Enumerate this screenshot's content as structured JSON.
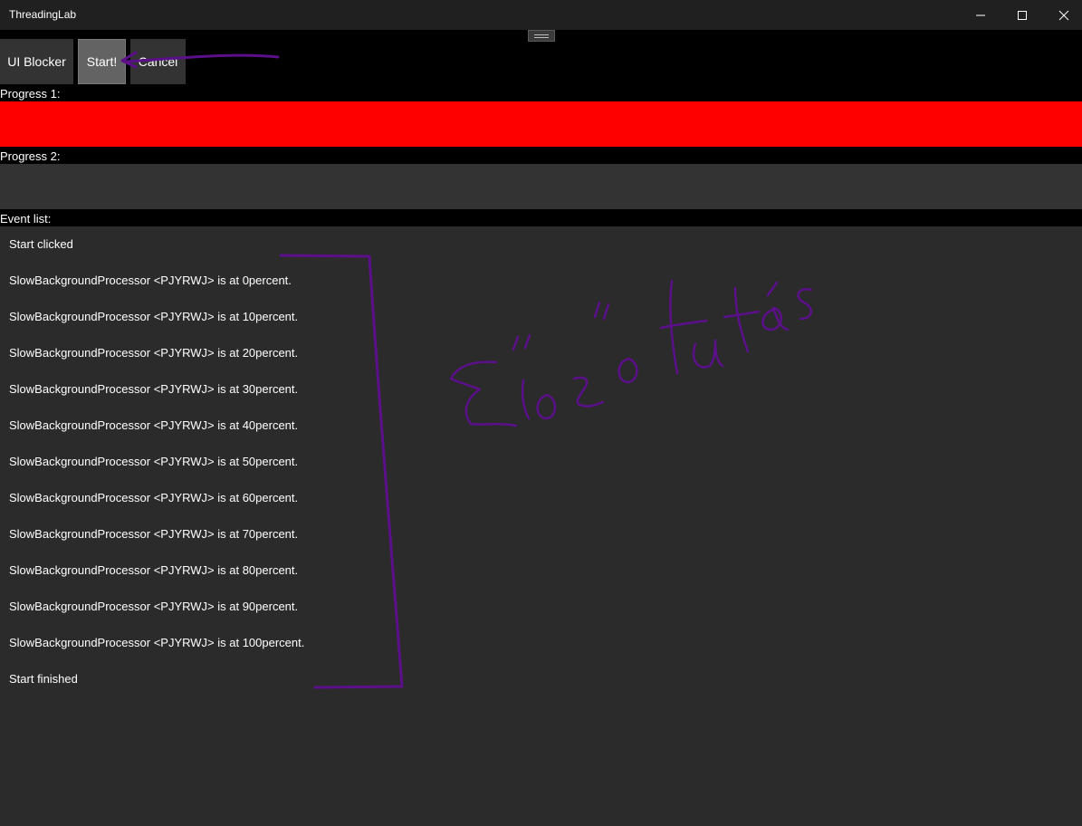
{
  "window": {
    "title": "ThreadingLab"
  },
  "toolbar": {
    "ui_blocker_label": "UI Blocker",
    "start_label": "Start!",
    "cancel_label": "Cancel"
  },
  "progress1": {
    "label": "Progress 1:",
    "value_percent": 100,
    "fill_color": "#ff0000"
  },
  "progress2": {
    "label": "Progress 2:",
    "value_percent": 0,
    "fill_color": "#ff0000"
  },
  "events": {
    "label": "Event list:",
    "items": [
      "Start clicked",
      "SlowBackgroundProcessor <PJYRWJ> is at 0percent.",
      "SlowBackgroundProcessor <PJYRWJ> is at 10percent.",
      "SlowBackgroundProcessor <PJYRWJ> is at 20percent.",
      "SlowBackgroundProcessor <PJYRWJ> is at 30percent.",
      "SlowBackgroundProcessor <PJYRWJ> is at 40percent.",
      "SlowBackgroundProcessor <PJYRWJ> is at 50percent.",
      "SlowBackgroundProcessor <PJYRWJ> is at 60percent.",
      "SlowBackgroundProcessor <PJYRWJ> is at 70percent.",
      "SlowBackgroundProcessor <PJYRWJ> is at 80percent.",
      "SlowBackgroundProcessor <PJYRWJ> is at 90percent.",
      "SlowBackgroundProcessor <PJYRWJ> is at 100percent.",
      "Start finished"
    ]
  },
  "annotation": {
    "text": "Előző futás",
    "ink_color": "#5b0f8a"
  }
}
